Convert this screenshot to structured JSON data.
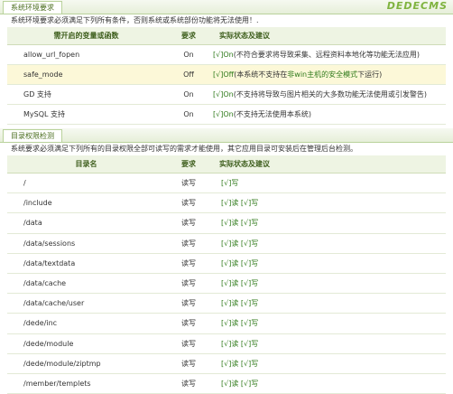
{
  "logo": "DEDECMS",
  "env": {
    "tab": "系统环境要求",
    "note": "系统环境要求必须满足下列所有条件，否则系统或系统部份功能将无法使用！.",
    "headers": [
      "需开启的变量或函数",
      "要求",
      "实际状态及建议"
    ],
    "rows": [
      {
        "name": "allow_url_fopen",
        "req": "On",
        "mark": "[√]",
        "status": "On",
        "advice": "(不符合要求将导致采集、远程资料本地化等功能无法应用)",
        "hl": false
      },
      {
        "name": "safe_mode",
        "req": "Off",
        "mark": "[√]",
        "status": "Off",
        "advice_a": "(本系统不支持在",
        "advice_b": "非win主机的安全模式",
        "advice_c": "下运行)",
        "hl": true
      },
      {
        "name": "GD 支持",
        "req": "On",
        "mark": "[√]",
        "status": "On",
        "advice": "(不支持将导致与图片相关的大多数功能无法使用或引发警告)",
        "hl": false
      },
      {
        "name": "MySQL 支持",
        "req": "On",
        "mark": "[√]",
        "status": "On",
        "advice": "(不支持无法使用本系统)",
        "hl": false
      }
    ]
  },
  "perm": {
    "tab": "目录权限检测",
    "note": "系统要求必须满足下列所有的目录权限全部可读写的需求才能使用，其它应用目录可安装后在管理后台检测。",
    "headers": [
      "目录名",
      "要求",
      "实际状态及建议"
    ],
    "rows": [
      {
        "dir": "/",
        "req": "读写",
        "read": "",
        "write": "[√]写"
      },
      {
        "dir": "/include",
        "req": "读写",
        "read": "[√]读",
        "write": "[√]写"
      },
      {
        "dir": "/data",
        "req": "读写",
        "read": "[√]读",
        "write": "[√]写"
      },
      {
        "dir": "/data/sessions",
        "req": "读写",
        "read": "[√]读",
        "write": "[√]写"
      },
      {
        "dir": "/data/textdata",
        "req": "读写",
        "read": "[√]读",
        "write": "[√]写"
      },
      {
        "dir": "/data/cache",
        "req": "读写",
        "read": "[√]读",
        "write": "[√]写"
      },
      {
        "dir": "/data/cache/user",
        "req": "读写",
        "read": "[√]读",
        "write": "[√]写"
      },
      {
        "dir": "/dede/inc",
        "req": "读写",
        "read": "[√]读",
        "write": "[√]写"
      },
      {
        "dir": "/dede/module",
        "req": "读写",
        "read": "[√]读",
        "write": "[√]写"
      },
      {
        "dir": "/dede/module/ziptmp",
        "req": "读写",
        "read": "[√]读",
        "write": "[√]写"
      },
      {
        "dir": "/member/templets",
        "req": "读写",
        "read": "[√]读",
        "write": "[√]写"
      }
    ]
  }
}
